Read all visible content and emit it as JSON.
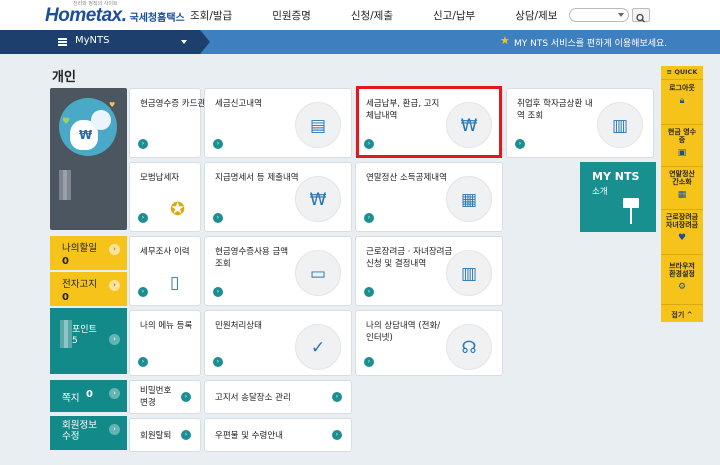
{
  "header": {
    "logo_main": "Hometax.",
    "logo_sub": "국세청홈택스",
    "logo_tag": "진리와 정직의 사이트",
    "nav": [
      "조회/발급",
      "민원증명",
      "신청/제출",
      "신고/납부",
      "상담/제보"
    ]
  },
  "mybar": {
    "label": "MyNTS",
    "notice": "MY NTS 서비스를 편하게 이용해보세요."
  },
  "section_title": "개인",
  "side": {
    "unpaid_label": "나의할일",
    "unpaid_count": "0",
    "ebill_label": "전자고지",
    "ebill_count": "0",
    "point_label": "포인트",
    "point_value": "5",
    "memo_label": "쪽지",
    "memo_count": "0",
    "member_label": "회원정보 수정"
  },
  "cards": {
    "c1": "현금영수증 카드관리",
    "c2": "세금신고내역",
    "c3": "세금납부, 환급, 고지 체납내역",
    "c4": "취업후 학자금상환 내역 조회",
    "c5": "모범납세자",
    "c6": "지급명세서 등 제출내역",
    "c7": "연말정산 소득공제내역",
    "c8": "세무조사 이력",
    "c9": "현금영수증사용 금액조회",
    "c10": "근로장려금 · 자녀장려금 신청 및 결정내역",
    "c11": "나의 메뉴 등록",
    "c12": "민원처리상태",
    "c13": "나의 상담내역 (전화/인터넷)",
    "s1": "비밀번호 변경",
    "s2": "고지서 송달장소 관리",
    "s3": "회원탈퇴",
    "s4": "우편물 및 수령안내"
  },
  "mynts_card": {
    "title": "MY NTS",
    "sub": "소개"
  },
  "quick": {
    "title": "≡ QUICK",
    "items": [
      "로그아웃",
      "현금 영수증",
      "연말정산 간소화",
      "근로장려금 자녀장려금",
      "브라우저 환경설정"
    ],
    "fold": "접기 ^"
  },
  "icons": [
    "search-icon",
    "hamburger-icon",
    "star-icon",
    "tax-document-icon",
    "won-coin-icon",
    "book-icon",
    "ribbon-icon",
    "receipt-icon",
    "calculator-icon",
    "checkmark-icon",
    "headset-icon",
    "signpost-icon"
  ]
}
